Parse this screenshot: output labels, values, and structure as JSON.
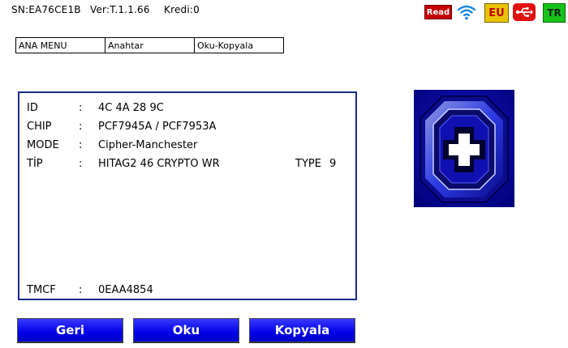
{
  "status": {
    "serial": "SN:EA76CE1B",
    "version": "Ver:T.1.1.66",
    "credit": "Kredi:0",
    "read_badge": "Read",
    "eu_badge": "EU",
    "lang_badge": "TR"
  },
  "breadcrumb": [
    "ANA MENU",
    "Anahtar",
    "Oku-Kopyala"
  ],
  "info": {
    "separator": ":",
    "id_label": "ID",
    "id_value": "4C 4A 28 9C",
    "chip_label": "CHIP",
    "chip_value": "PCF7945A / PCF7953A",
    "mode_label": "MODE",
    "mode_value": "Cipher-Manchester",
    "tip_label": "TİP",
    "tip_value": "HITAG2 46 CRYPTO WR",
    "type_label": "TYPE",
    "type_value": "9",
    "tmcf_label": "TMCF",
    "tmcf_value": "0EAA4854"
  },
  "buttons": {
    "back": "Geri",
    "read": "Oku",
    "copy": "Kopyala"
  },
  "colors": {
    "button_blue": "#0000e6",
    "panel_border": "#1a2a8a",
    "read_red": "#c40000",
    "eu_yellow": "#e8c400",
    "tr_green": "#17c21a"
  },
  "icons": {
    "wifi": "wifi-icon",
    "usb": "usb-icon",
    "key_slot": "transponder-slot-image"
  }
}
